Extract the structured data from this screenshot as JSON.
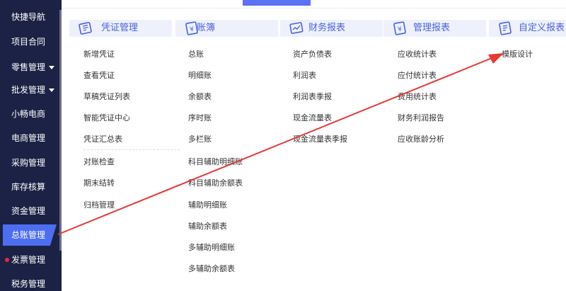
{
  "sidebar": {
    "items": [
      {
        "label": "快捷导航"
      },
      {
        "label": "项目合同"
      },
      {
        "label": "零售管理"
      },
      {
        "label": "批发管理"
      },
      {
        "label": "小畅电商"
      },
      {
        "label": "电商管理"
      },
      {
        "label": "采购管理"
      },
      {
        "label": "库存核算"
      },
      {
        "label": "资金管理"
      },
      {
        "label": "总账管理"
      },
      {
        "label": "发票管理"
      },
      {
        "label": "税务管理"
      }
    ]
  },
  "columns": [
    {
      "title": "凭证管理",
      "icon": "voucher-icon",
      "items": [
        "新增凭证",
        "查看凭证",
        "草稿凭证列表",
        "智能凭证中心",
        "凭证汇总表",
        "对账检查",
        "期末结转",
        "归档管理"
      ]
    },
    {
      "title": "账簿",
      "icon": "ledger-book-icon",
      "items": [
        "总账",
        "明细账",
        "余额表",
        "序时账",
        "多栏账",
        "科目辅助明细账",
        "科目辅助余额表",
        "辅助明细账",
        "辅助余额表",
        "多辅助明细账",
        "多辅助余额表"
      ]
    },
    {
      "title": "财务报表",
      "icon": "financial-report-icon",
      "items": [
        "资产负债表",
        "利润表",
        "利润表季报",
        "现金流量表",
        "现金流量表季报"
      ]
    },
    {
      "title": "管理报表",
      "icon": "management-report-icon",
      "items": [
        "应收统计表",
        "应付统计表",
        "费用统计表",
        "财务利润报告",
        "应收账龄分析"
      ]
    },
    {
      "title": "自定义报表",
      "icon": "custom-report-icon",
      "items": [
        "模版设计"
      ]
    }
  ],
  "colors": {
    "sidebar_bg": "#1b2245",
    "active_item": "#4e6ef2",
    "accent": "#4a63e6",
    "header_bg": "#eef1fb",
    "annotation_arrow": "#e53935",
    "badge_dot": "#e8293a"
  }
}
